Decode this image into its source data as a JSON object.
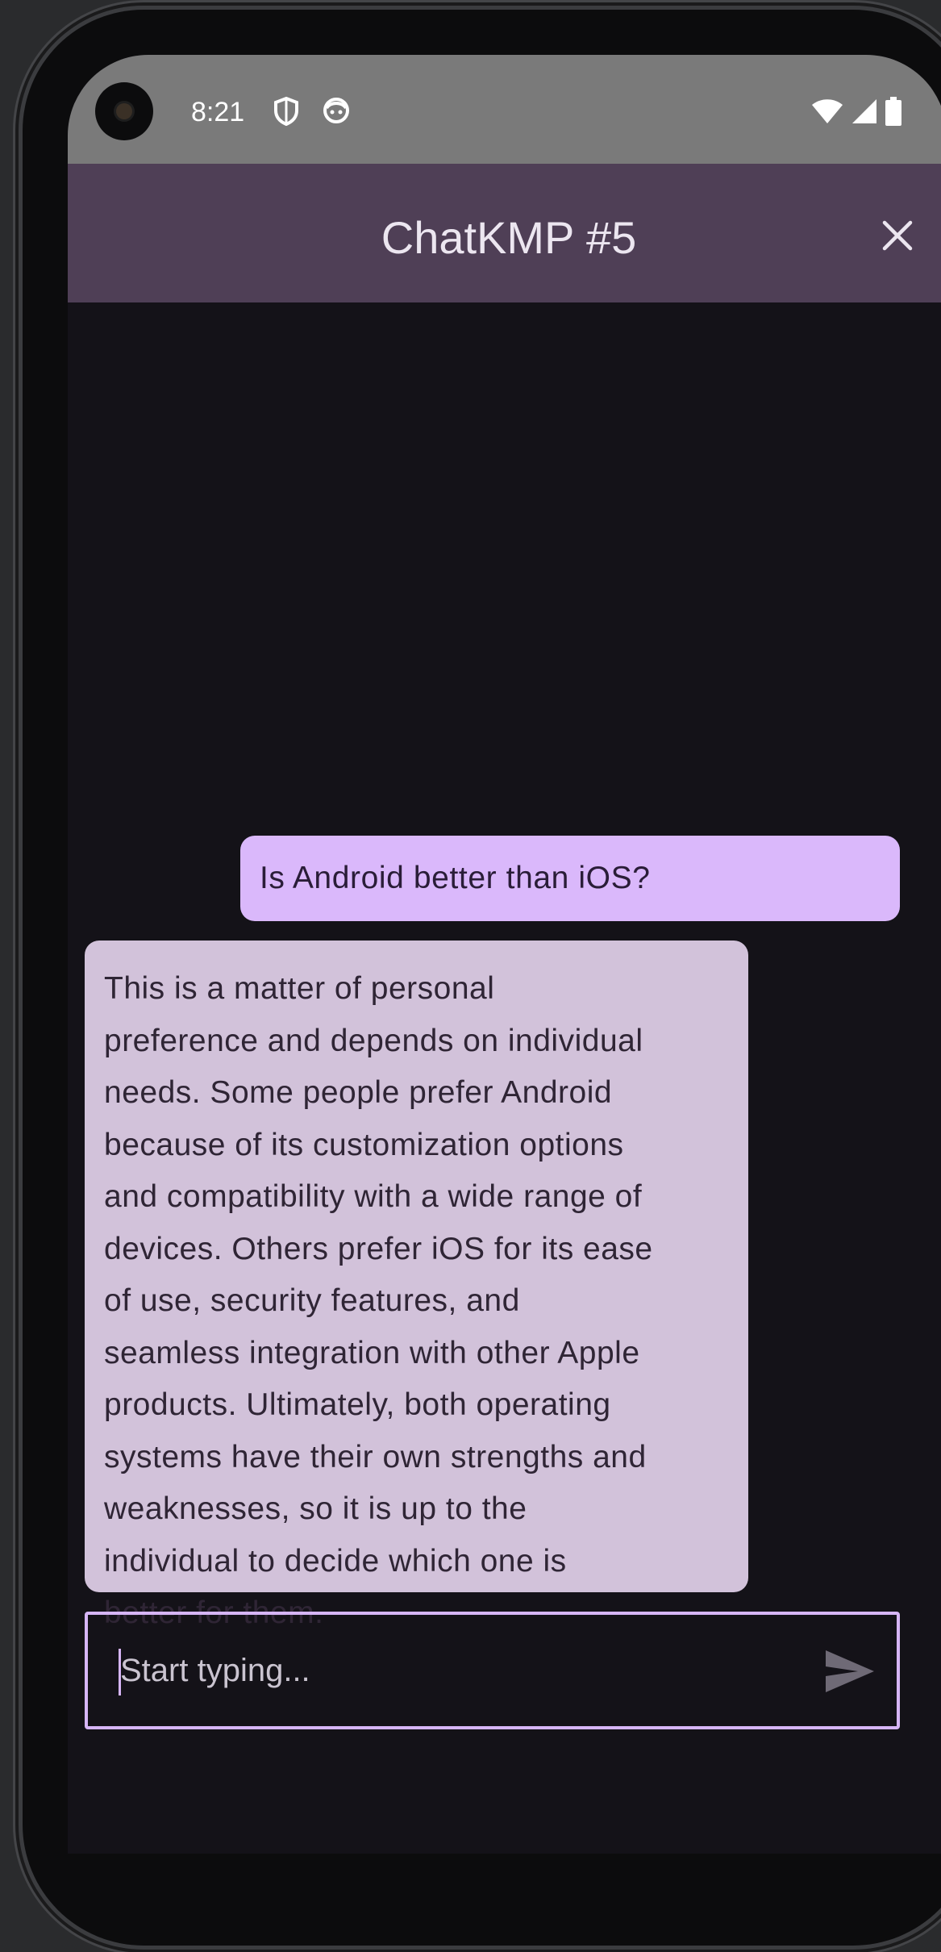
{
  "status_bar": {
    "time": "8:21"
  },
  "app_bar": {
    "title": "ChatKMP #5"
  },
  "messages": [
    {
      "role": "user",
      "text": "Is Android better than iOS?"
    },
    {
      "role": "assistant",
      "lines": [
        "This is a matter of personal",
        "preference and depends on individual",
        "needs. Some people prefer Android",
        "because of its customization options",
        "and compatibility with a wide range of",
        "devices. Others prefer iOS for its ease",
        "of use, security features, and",
        "seamless integration with other Apple",
        "products. Ultimately, both operating",
        "systems have their own strengths and",
        "weaknesses, so it is up to the",
        "individual to decide which one is",
        "better for them."
      ]
    }
  ],
  "composer": {
    "placeholder": "Start typing..."
  },
  "icons": {
    "close": "close-icon",
    "send": "send-icon",
    "shield": "shield-icon",
    "face": "face-icon",
    "wifi": "wifi-icon",
    "signal": "signal-icon",
    "battery": "battery-icon"
  },
  "colors": {
    "app_bar": "#4f3f56",
    "background": "#141218",
    "user_bubble": "#dab8fb",
    "assistant_bubble": "#d2c2da",
    "input_border": "#d6b5f6"
  }
}
